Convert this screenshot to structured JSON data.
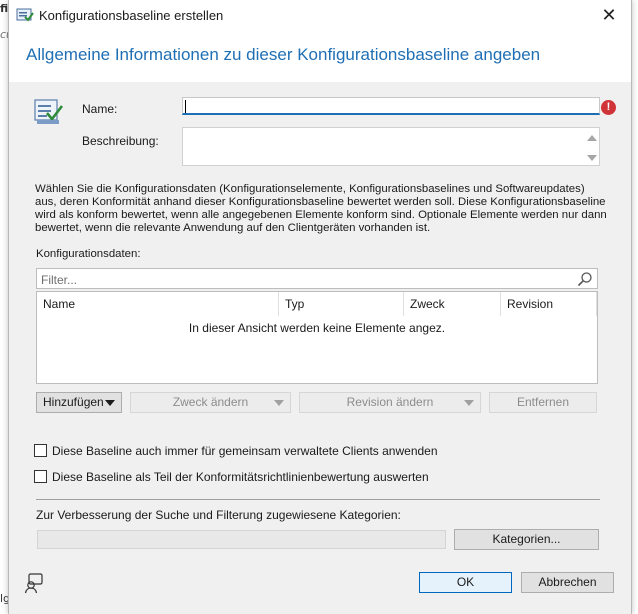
{
  "background_window": {
    "fragments": [
      "fi",
      "cu",
      "lg"
    ]
  },
  "dialog": {
    "title": "Konfigurationsbaseline erstellen",
    "close_symbol": "✕",
    "heading": "Allgemeine Informationen zu dieser Konfigurationsbaseline angeben",
    "name_label": "Name:",
    "name_value": "",
    "error_symbol": "!",
    "description_label": "Beschreibung:",
    "description_value": "",
    "info_text": "Wählen Sie die Konfigurationsdaten (Konfigurationselemente, Konfigurationsbaselines und Softwareupdates) aus, deren Konformität anhand dieser Konfigurationsbaseline bewertet werden soll. Diese Konfigurationsbaseline wird als konform bewertet, wenn alle angegebenen Elemente konform sind. Optionale Elemente werden nur dann bewertet, wenn die relevante Anwendung auf den Clientgeräten vorhanden ist.",
    "config_data_label": "Konfigurationsdaten:",
    "filter_placeholder": "Filter...",
    "columns": [
      "Name",
      "Typ",
      "Zweck",
      "Revision"
    ],
    "empty_message": "In dieser Ansicht werden keine Elemente angez.",
    "buttons": {
      "add": "Hinzufügen",
      "change_purpose": "Zweck ändern",
      "change_revision": "Revision ändern",
      "remove": "Entfernen",
      "categories": "Kategorien...",
      "ok": "OK",
      "cancel": "Abbrechen"
    },
    "checkbox_cogenerated": "Diese Baseline auch immer für gemeinsam verwaltete Clients anwenden",
    "checkbox_compliance": "Diese Baseline als Teil der Konformitätsrichtlinienbewertung auswerten",
    "categories_label": "Zur Verbesserung der Suche und Filterung zugewiesene Kategorien:",
    "categories_value": "",
    "colors": {
      "heading": "#1f6fb5",
      "error": "#d13438",
      "ok_border": "#0067c0"
    },
    "icons": [
      "config-baseline-icon",
      "close-icon",
      "error-icon",
      "search-icon",
      "dropdown-arrow-icon",
      "feedback-icon"
    ]
  }
}
